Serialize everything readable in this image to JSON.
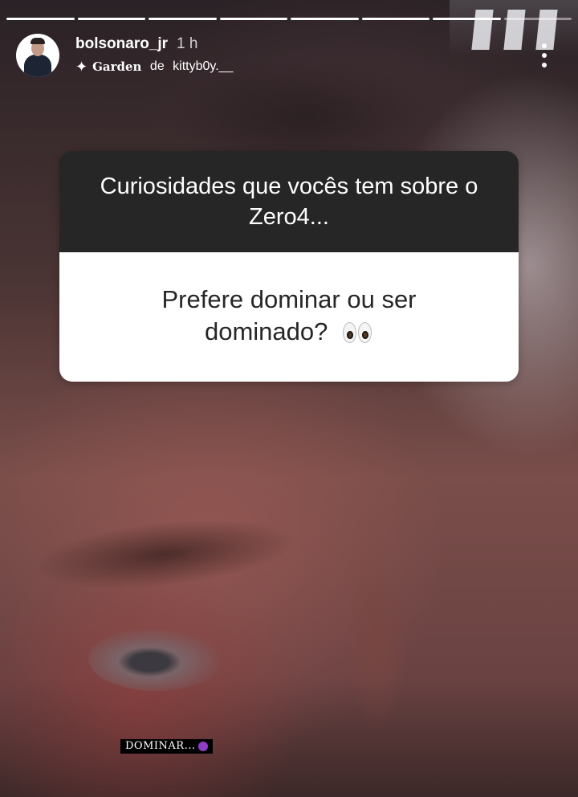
{
  "story": {
    "progress": {
      "total_segments": 8,
      "completed_segments": 7
    },
    "user": {
      "username": "bolsonaro_jr",
      "time_ago": "1 h"
    },
    "music": {
      "song": "Garden",
      "connector": " de ",
      "artist": "kittyb0y.__"
    },
    "more_icon": "more-vertical-icon",
    "question_box": {
      "question": "Curiosidades que vocês tem sobre o Zero4...",
      "answer": "Prefere dominar ou ser dominado?",
      "answer_emoji": "eyes-emoji"
    },
    "sticker_text": "DOMINAR...",
    "sticker_emoji": "smiling-devil-emoji"
  },
  "colors": {
    "question_header_bg": "#262626",
    "answer_bg": "#ffffff",
    "text_dark": "#262626",
    "text_light": "#ffffff"
  }
}
